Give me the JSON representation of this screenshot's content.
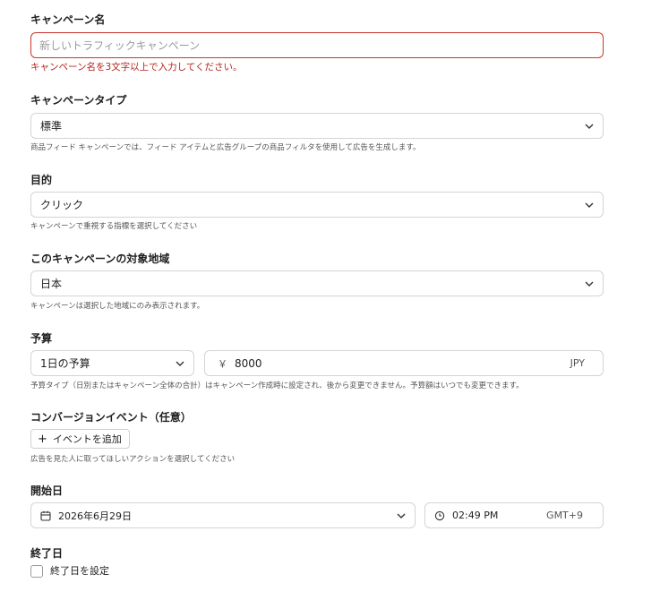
{
  "campaign_name": {
    "label": "キャンペーン名",
    "placeholder": "新しいトラフィックキャンペーン",
    "value": "",
    "error": "キャンペーン名を3文字以上で入力してください。"
  },
  "campaign_type": {
    "label": "キャンペーンタイプ",
    "selected": "標準",
    "help": "商品フィード キャンペーンでは、フィード アイテムと広告グループの商品フィルタを使用して広告を生成します。"
  },
  "objective": {
    "label": "目的",
    "selected": "クリック",
    "help": "キャンペーンで重視する指標を選択してください"
  },
  "target_region": {
    "label": "このキャンペーンの対象地域",
    "selected": "日本",
    "help": "キャンペーンは選択した地域にのみ表示されます。"
  },
  "budget": {
    "label": "予算",
    "type_selected": "1日の予算",
    "currency_symbol": "￥",
    "amount": "8000",
    "currency_code": "JPY",
    "help": "予算タイプ（日別またはキャンペーン全体の合計）はキャンペーン作成時に設定され、後から変更できません。予算額はいつでも変更できます。"
  },
  "conversion_event": {
    "label": "コンバージョンイベント（任意）",
    "add_button": "イベントを追加",
    "help": "広告を見た人に取ってほしいアクションを選択してください"
  },
  "start_date": {
    "label": "開始日",
    "date": "2026年6月29日",
    "time": "02:49 PM",
    "timezone": "GMT+9"
  },
  "end_date": {
    "label": "終了日",
    "checkbox_label": "終了日を設定",
    "checked": false
  },
  "colors": {
    "error": "#c9352b",
    "border": "#d4d4d4",
    "text": "#1f1f1f",
    "muted": "#555555"
  }
}
